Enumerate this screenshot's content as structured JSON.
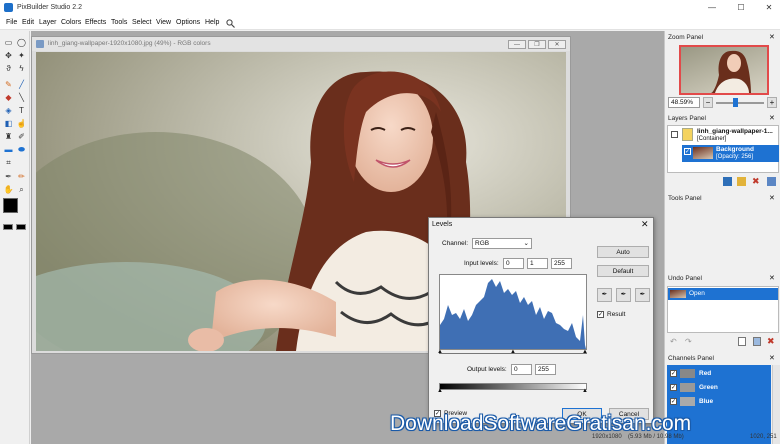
{
  "app": {
    "title": "PixBuilder Studio 2.2"
  },
  "window_controls": {
    "minimize": "—",
    "maximize": "☐",
    "close": "✕"
  },
  "menu": [
    "File",
    "Edit",
    "Layer",
    "Colors",
    "Effects",
    "Tools",
    "Select",
    "View",
    "Options",
    "Help"
  ],
  "document": {
    "title": "linh_giang-wallpaper-1920x1080.jpg (49%) - RGB colors"
  },
  "levels": {
    "title": "Levels",
    "close": "✕",
    "channel_label": "Channel:",
    "channel_value": "RGB",
    "input_label": "Input levels:",
    "input_values": [
      "0",
      "1",
      "255"
    ],
    "output_label": "Output levels:",
    "output_values": [
      "0",
      "255"
    ],
    "buttons": {
      "auto": "Auto",
      "default": "Default",
      "ok": "OK",
      "cancel": "Cancel"
    },
    "result_label": "Result",
    "preview_label": "Preview",
    "histogram_color": "#3f6fb4"
  },
  "zoom_panel": {
    "title": "Zoom Panel",
    "zoom_value": "48.59%"
  },
  "layers_panel": {
    "title": "Layers Panel",
    "layers": [
      {
        "name": "linh_giang-wallpaper-1...",
        "sub": "[Container]"
      },
      {
        "name": "Background",
        "sub": "[Opacity: 256]"
      }
    ]
  },
  "tools_panel": {
    "title": "Tools Panel"
  },
  "undo_panel": {
    "title": "Undo Panel",
    "items": [
      "Open"
    ]
  },
  "channels_panel": {
    "title": "Channels Panel",
    "channels": [
      "Red",
      "Green",
      "Blue"
    ]
  },
  "status": {
    "size": "1920x1080",
    "memory": "(5.93 Mb / 10.98 Mb)",
    "coords": "1020, 251"
  },
  "watermark": "DownloadSoftwareGratisan.com",
  "colors": {
    "accent": "#1e72d2",
    "workspace": "#a9a9a9"
  }
}
